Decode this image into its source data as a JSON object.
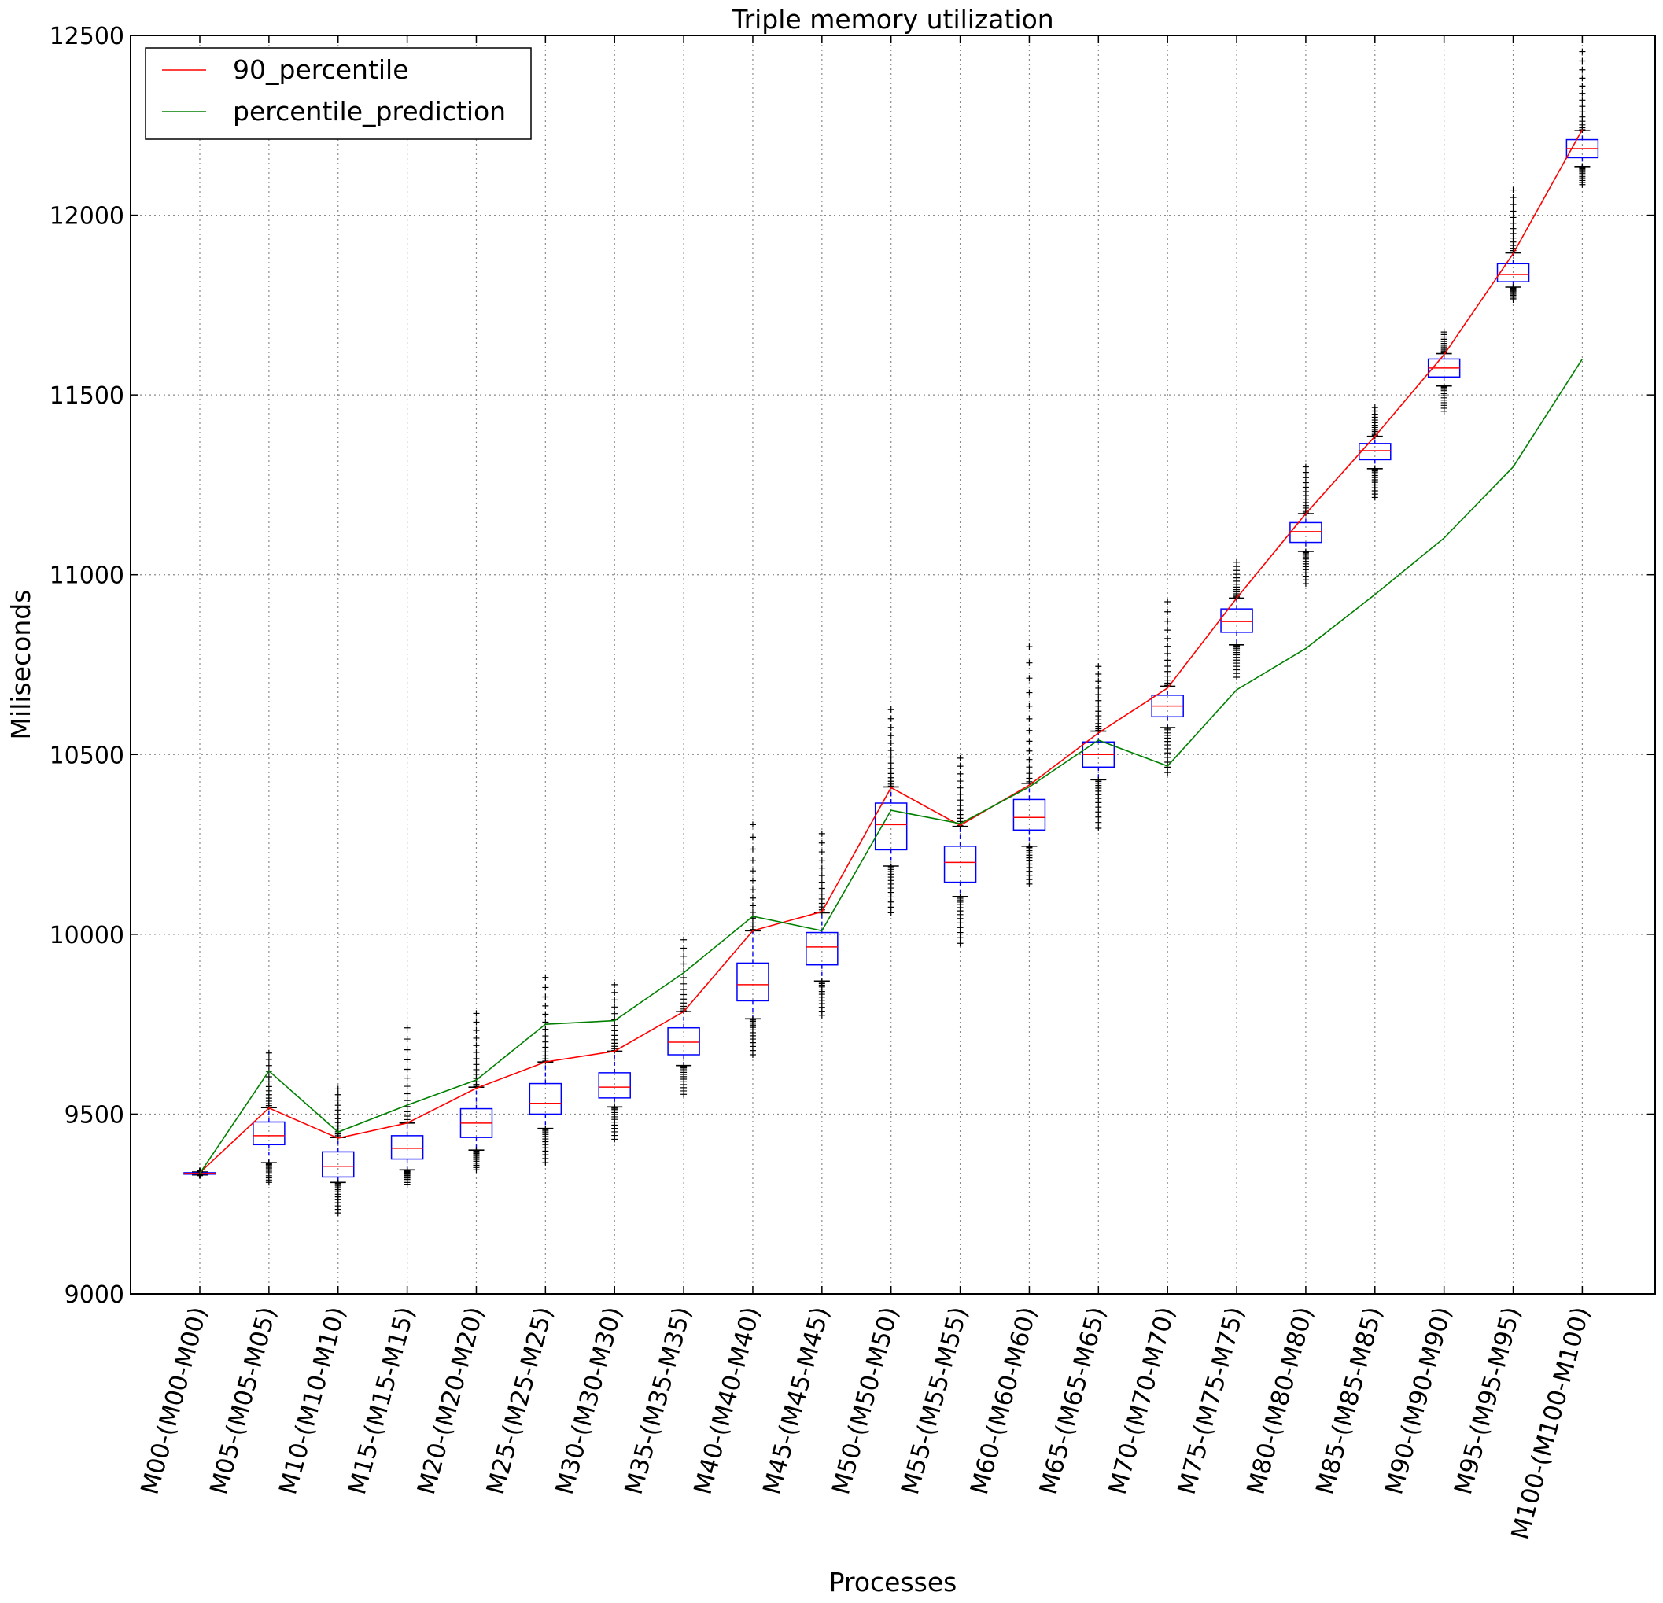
{
  "chart_data": {
    "type": "box",
    "title": "Triple memory utilization",
    "xlabel": "Processes",
    "ylabel": "Miliseconds",
    "ylim": [
      9000,
      12500
    ],
    "yticks": [
      9000,
      9500,
      10000,
      10500,
      11000,
      11500,
      12000,
      12500
    ],
    "grid": true,
    "legend_position": "top-left",
    "categories": [
      "M00-(M00-M00)",
      "M05-(M05-M05)",
      "M10-(M10-M10)",
      "M15-(M15-M15)",
      "M20-(M20-M20)",
      "M25-(M25-M25)",
      "M30-(M30-M30)",
      "M35-(M35-M35)",
      "M40-(M40-M40)",
      "M45-(M45-M45)",
      "M50-(M50-M50)",
      "M55-(M55-M55)",
      "M60-(M60-M60)",
      "M65-(M65-M65)",
      "M70-(M70-M70)",
      "M75-(M75-M75)",
      "M80-(M80-M80)",
      "M85-(M85-M85)",
      "M90-(M90-M90)",
      "M95-(M95-M95)",
      "M100-(M100-M100)"
    ],
    "boxes": [
      {
        "q1": 9333,
        "median": 9335,
        "q3": 9337,
        "whisker_low": 9331,
        "whisker_high": 9339,
        "flier_low": 9329,
        "flier_high": 9343
      },
      {
        "q1": 9415,
        "median": 9440,
        "q3": 9478,
        "whisker_low": 9365,
        "whisker_high": 9518,
        "flier_low": 9310,
        "flier_high": 9670
      },
      {
        "q1": 9325,
        "median": 9355,
        "q3": 9395,
        "whisker_low": 9310,
        "whisker_high": 9435,
        "flier_low": 9225,
        "flier_high": 9570
      },
      {
        "q1": 9375,
        "median": 9405,
        "q3": 9440,
        "whisker_low": 9345,
        "whisker_high": 9475,
        "flier_low": 9305,
        "flier_high": 9740
      },
      {
        "q1": 9435,
        "median": 9475,
        "q3": 9515,
        "whisker_low": 9400,
        "whisker_high": 9575,
        "flier_low": 9345,
        "flier_high": 9780
      },
      {
        "q1": 9500,
        "median": 9530,
        "q3": 9585,
        "whisker_low": 9460,
        "whisker_high": 9645,
        "flier_low": 9365,
        "flier_high": 9880
      },
      {
        "q1": 9545,
        "median": 9575,
        "q3": 9615,
        "whisker_low": 9520,
        "whisker_high": 9675,
        "flier_low": 9430,
        "flier_high": 9860
      },
      {
        "q1": 9665,
        "median": 9700,
        "q3": 9740,
        "whisker_low": 9635,
        "whisker_high": 9785,
        "flier_low": 9555,
        "flier_high": 9985
      },
      {
        "q1": 9815,
        "median": 9860,
        "q3": 9920,
        "whisker_low": 9765,
        "whisker_high": 10010,
        "flier_low": 9665,
        "flier_high": 10305
      },
      {
        "q1": 9915,
        "median": 9965,
        "q3": 10005,
        "whisker_low": 9870,
        "whisker_high": 10060,
        "flier_low": 9775,
        "flier_high": 10280
      },
      {
        "q1": 10235,
        "median": 10305,
        "q3": 10365,
        "whisker_low": 10190,
        "whisker_high": 10410,
        "flier_low": 10060,
        "flier_high": 10625
      },
      {
        "q1": 10145,
        "median": 10200,
        "q3": 10245,
        "whisker_low": 10105,
        "whisker_high": 10300,
        "flier_low": 9975,
        "flier_high": 10490
      },
      {
        "q1": 10290,
        "median": 10325,
        "q3": 10375,
        "whisker_low": 10245,
        "whisker_high": 10420,
        "flier_low": 10140,
        "flier_high": 10800
      },
      {
        "q1": 10465,
        "median": 10500,
        "q3": 10535,
        "whisker_low": 10430,
        "whisker_high": 10565,
        "flier_low": 10295,
        "flier_high": 10745
      },
      {
        "q1": 10605,
        "median": 10635,
        "q3": 10665,
        "whisker_low": 10575,
        "whisker_high": 10690,
        "flier_low": 10450,
        "flier_high": 10925
      },
      {
        "q1": 10840,
        "median": 10870,
        "q3": 10905,
        "whisker_low": 10805,
        "whisker_high": 10935,
        "flier_low": 10715,
        "flier_high": 11035
      },
      {
        "q1": 11090,
        "median": 11120,
        "q3": 11145,
        "whisker_low": 11065,
        "whisker_high": 11170,
        "flier_low": 10975,
        "flier_high": 11300
      },
      {
        "q1": 11320,
        "median": 11345,
        "q3": 11365,
        "whisker_low": 11295,
        "whisker_high": 11385,
        "flier_low": 11215,
        "flier_high": 11465
      },
      {
        "q1": 11550,
        "median": 11575,
        "q3": 11600,
        "whisker_low": 11525,
        "whisker_high": 11615,
        "flier_low": 11455,
        "flier_high": 11675
      },
      {
        "q1": 11815,
        "median": 11835,
        "q3": 11865,
        "whisker_low": 11800,
        "whisker_high": 11895,
        "flier_low": 11765,
        "flier_high": 12070
      },
      {
        "q1": 12160,
        "median": 12185,
        "q3": 12210,
        "whisker_low": 12135,
        "whisker_high": 12235,
        "flier_low": 12085,
        "flier_high": 12455
      }
    ],
    "series": [
      {
        "name": "90_percentile",
        "color": "#ff0000",
        "values": [
          9337,
          9517,
          9433,
          9475,
          9572,
          9645,
          9675,
          9785,
          10010,
          10063,
          10408,
          10303,
          10415,
          10560,
          10685,
          10935,
          11170,
          11385,
          11612,
          11893,
          12238
        ]
      },
      {
        "name": "percentile_prediction",
        "color": "#008000",
        "values": [
          9335,
          9620,
          9450,
          9525,
          9595,
          9750,
          9760,
          9893,
          10050,
          10010,
          10345,
          10308,
          10410,
          10540,
          10468,
          10680,
          10795,
          10945,
          11102,
          11300,
          11600
        ]
      }
    ],
    "box_color": "#0000ff",
    "median_color": "#ff0000"
  }
}
